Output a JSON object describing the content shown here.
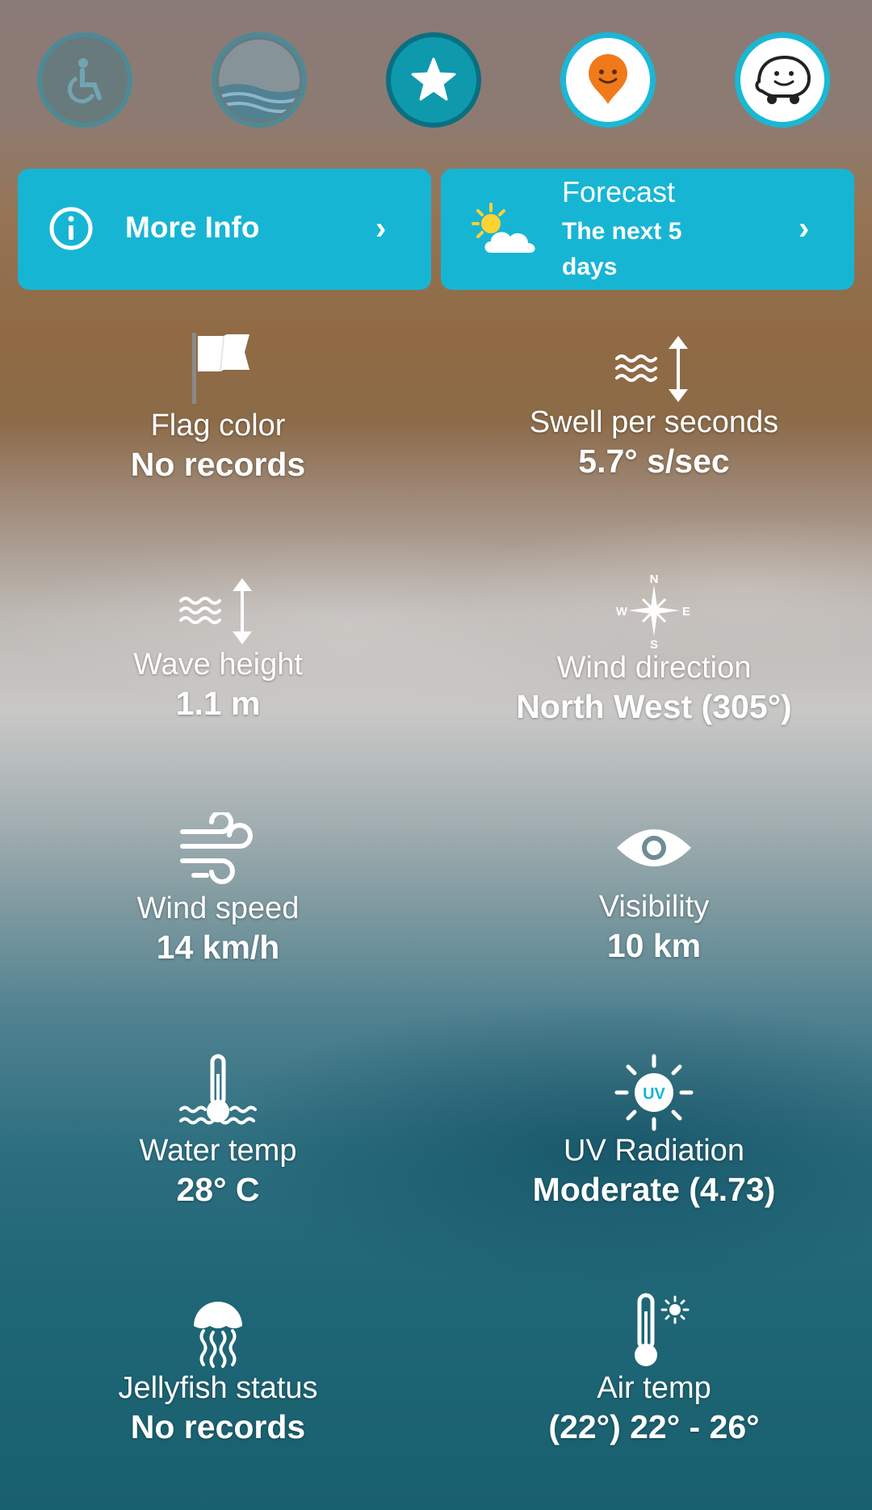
{
  "actions": [
    {
      "icon": "accessibility-icon",
      "state": "inactive"
    },
    {
      "icon": "blue-flag-icon",
      "state": "inactive"
    },
    {
      "icon": "star-icon",
      "state": "favorite"
    },
    {
      "icon": "map-pin-icon",
      "state": "active"
    },
    {
      "icon": "waze-icon",
      "state": "active"
    }
  ],
  "more_info": {
    "label": "More Info",
    "icon": "info-icon"
  },
  "forecast": {
    "title": "Forecast",
    "subtitle_line1": "The next 5",
    "subtitle_line2": "days",
    "icon": "partly-sunny-icon"
  },
  "stats": {
    "flag": {
      "label": "Flag color",
      "value": "No records",
      "icon": "flag-icon"
    },
    "swell": {
      "label": "Swell per seconds",
      "value": "5.7° s/sec",
      "icon": "swell-icon"
    },
    "wave": {
      "label": "Wave height",
      "value": "1.1 m",
      "icon": "wave-height-icon"
    },
    "wind_dir": {
      "label": "Wind direction",
      "value": "North West (305°)",
      "icon": "compass-icon",
      "compass": {
        "n": "N",
        "e": "E",
        "s": "S",
        "w": "W"
      }
    },
    "wind_speed": {
      "label": "Wind speed",
      "value": "14 km/h",
      "icon": "wind-icon"
    },
    "visibility": {
      "label": "Visibility",
      "value": "10 km",
      "icon": "eye-icon"
    },
    "water_temp": {
      "label": "Water temp",
      "value": "28° C",
      "icon": "water-thermometer-icon"
    },
    "uv": {
      "label": "UV Radiation",
      "value": "Moderate (4.73)",
      "icon": "uv-sun-icon",
      "badge": "UV"
    },
    "jellyfish": {
      "label": "Jellyfish status",
      "value": "No records",
      "icon": "jellyfish-icon"
    },
    "air_temp": {
      "label": "Air temp",
      "value": "(22°) 22° - 26°",
      "icon": "air-thermometer-icon"
    }
  },
  "colors": {
    "accent": "#17b5d4",
    "accent_dark": "#0f99ad",
    "pin": "#f07a1a"
  }
}
